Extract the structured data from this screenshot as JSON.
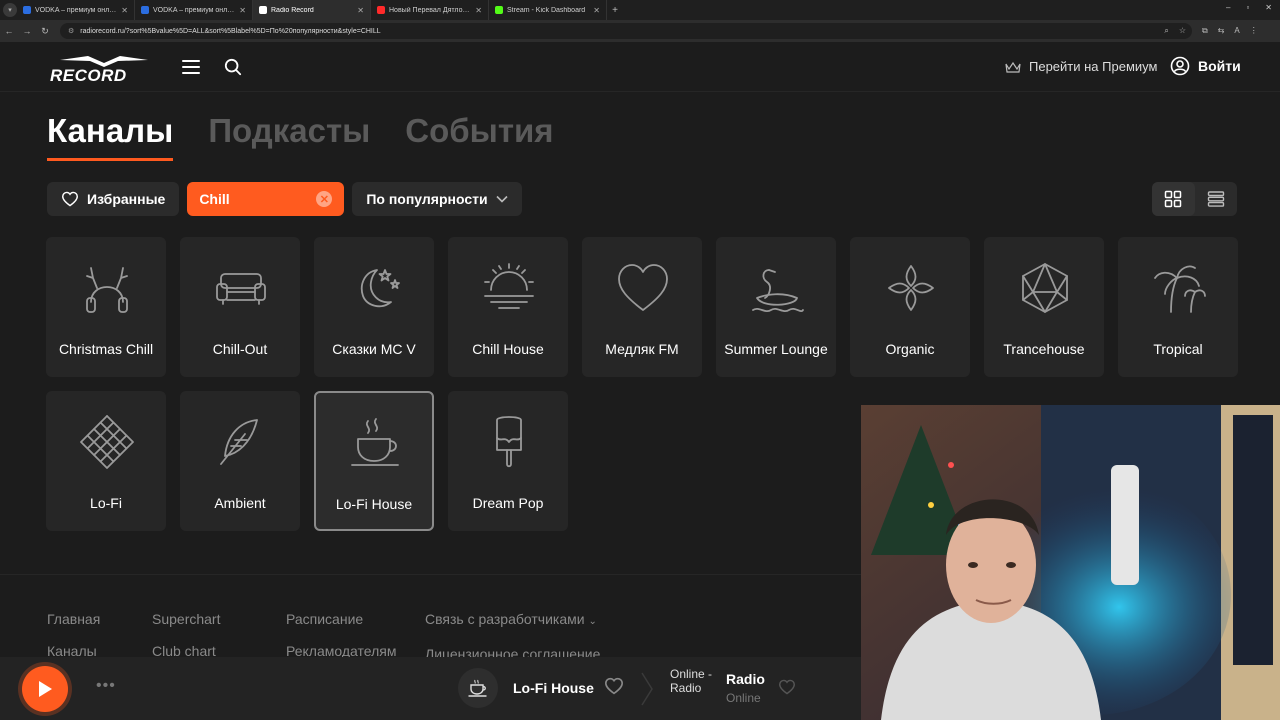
{
  "browser": {
    "tabs": [
      {
        "title": "VODKA – премиум онлайн-ка",
        "favicon_color": "#2b6de0",
        "active": false
      },
      {
        "title": "VODKA – премиум онлайн-ка",
        "favicon_color": "#2b6de0",
        "active": false
      },
      {
        "title": "Radio Record",
        "favicon_color": "#ffffff",
        "active": true
      },
      {
        "title": "Новый Перевал Дятлова! Это",
        "favicon_color": "#ff2a2a",
        "active": false
      },
      {
        "title": "Stream - Kick Dashboard",
        "favicon_color": "#53fc18",
        "active": false
      }
    ],
    "url": "radiorecord.ru/?sort%5Bvalue%5D=ALL&sort%5Blabel%5D=По%20популярности&style=CHILL"
  },
  "header": {
    "logo_text": "RECORD",
    "premium_label": "Перейти на Премиум",
    "login_label": "Войти"
  },
  "section_tabs": [
    "Каналы",
    "Подкасты",
    "События"
  ],
  "filters": {
    "favorites_label": "Избранные",
    "style_label": "Chill",
    "sort_label": "По популярности"
  },
  "channels": [
    {
      "name": "Christmas Chill",
      "icon": "reindeer-headphones-icon"
    },
    {
      "name": "Chill-Out",
      "icon": "sofa-icon"
    },
    {
      "name": "Сказки MC V",
      "icon": "moon-stars-icon"
    },
    {
      "name": "Chill House",
      "icon": "sunset-icon"
    },
    {
      "name": "Медляк FM",
      "icon": "heart-icon"
    },
    {
      "name": "Summer Lounge",
      "icon": "swan-float-icon"
    },
    {
      "name": "Organic",
      "icon": "flower-icon"
    },
    {
      "name": "Trancehouse",
      "icon": "polyhedron-icon"
    },
    {
      "name": "Tropical",
      "icon": "palm-trees-icon"
    },
    {
      "name": "Lo-Fi",
      "icon": "lattice-icon"
    },
    {
      "name": "Ambient",
      "icon": "feather-icon"
    },
    {
      "name": "Lo-Fi House",
      "icon": "coffee-cup-icon",
      "selected": true
    },
    {
      "name": "Dream Pop",
      "icon": "ice-cream-icon"
    }
  ],
  "footer": {
    "col1": [
      "Главная",
      "Каналы"
    ],
    "col2": [
      "Superchart",
      "Club chart"
    ],
    "col3": [
      "Расписание",
      "Рекламодателям"
    ],
    "col4": [
      "Связь с разработчиками",
      "Лицензионное соглашение"
    ]
  },
  "player": {
    "now_playing": "Lo-Fi House",
    "alt_text": "Online - Radio",
    "radio_title": "Radio",
    "radio_subtitle": "Online"
  },
  "colors": {
    "accent": "#ff5b1f",
    "background": "#1c1c1c",
    "card": "#262626"
  }
}
